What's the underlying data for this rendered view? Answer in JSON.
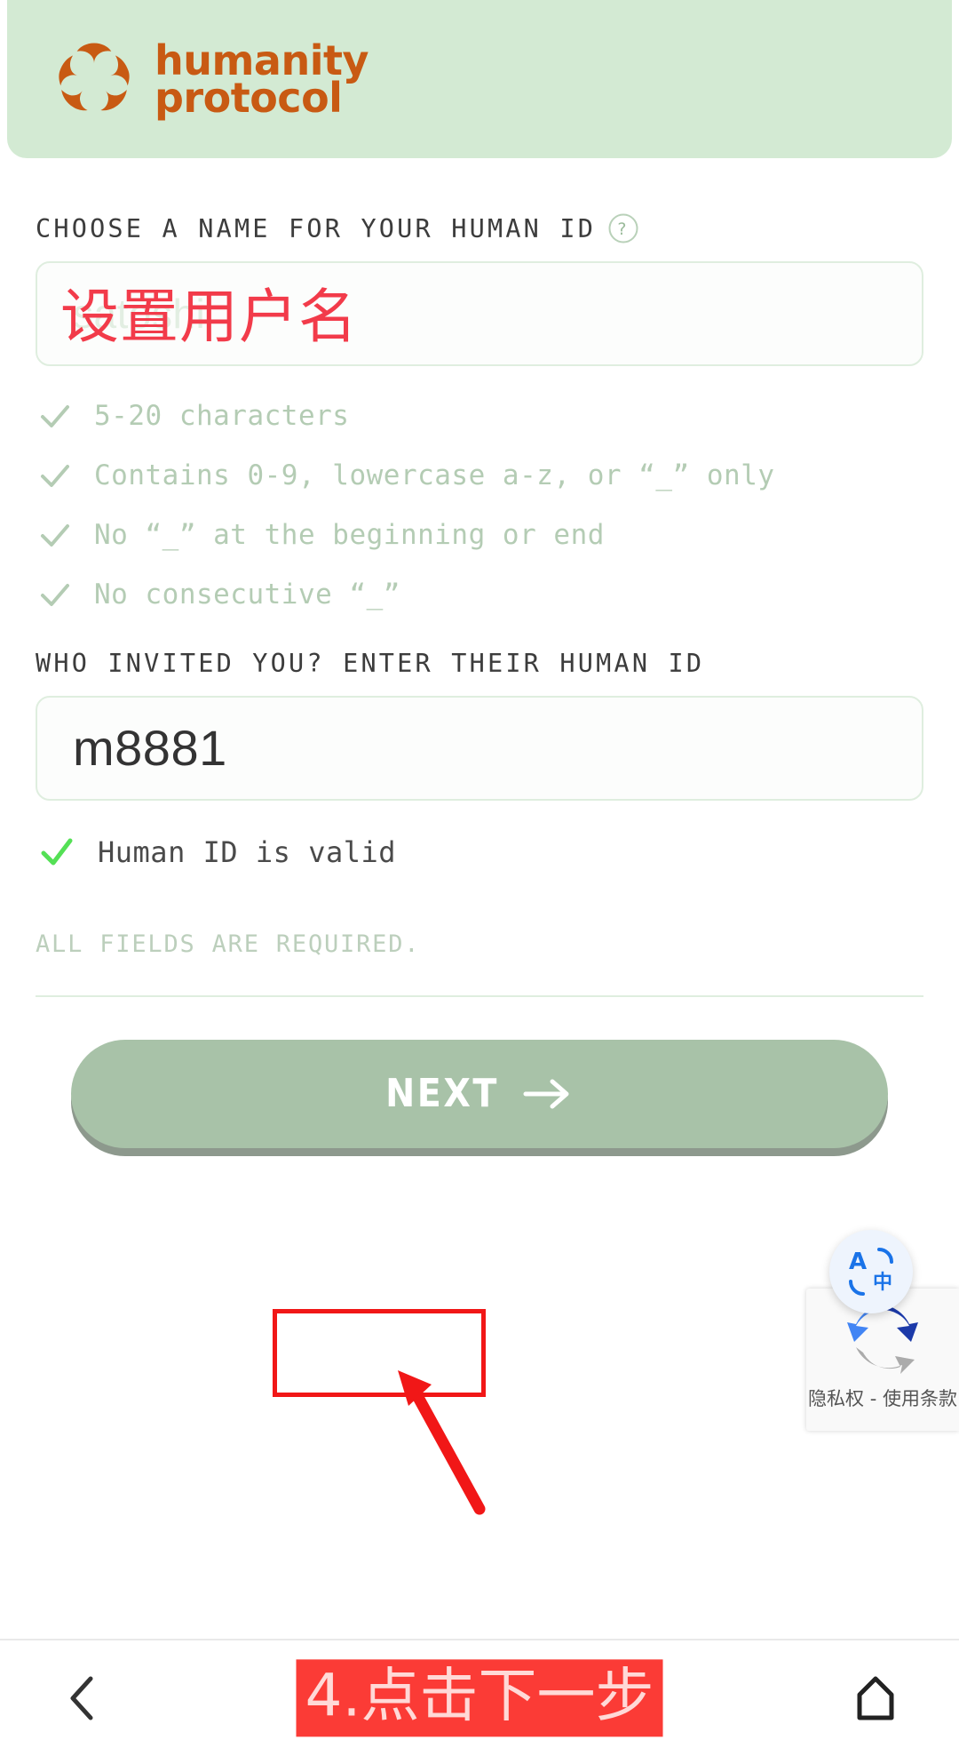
{
  "header": {
    "brand_line1": "humanity",
    "brand_line2": "protocol",
    "logo_icon": "humanity-protocol-logo",
    "bg_color": "#d3ead3",
    "brand_color": "#c85a13"
  },
  "form": {
    "name_field": {
      "label": "CHOOSE A NAME FOR YOUR HUMAN ID",
      "help_icon": "question-mark-icon",
      "placeholder": "satoshi",
      "value": "",
      "overlay_annotation": "设置用户名",
      "overlay_color": "#f23b4a"
    },
    "rules": [
      {
        "icon": "check-icon",
        "text": "5-20 characters",
        "state": "satisfied"
      },
      {
        "icon": "check-icon",
        "text": "Contains 0-9, lowercase a-z, or “_” only",
        "state": "satisfied"
      },
      {
        "icon": "check-icon",
        "text": "No “_” at the beginning or end",
        "state": "satisfied"
      },
      {
        "icon": "check-icon",
        "text": "No consecutive “_”",
        "state": "satisfied"
      }
    ],
    "inviter_field": {
      "label": "WHO INVITED YOU? ENTER THEIR HUMAN ID",
      "value": "m8881",
      "placeholder": ""
    },
    "validation": {
      "icon": "check-icon",
      "text": "Human ID is valid",
      "color": "#54e055"
    },
    "required_note": "ALL FIELDS ARE REQUIRED."
  },
  "actions": {
    "next_label": "NEXT",
    "next_arrow_icon": "arrow-right-icon",
    "next_bg_color": "#a8c2a8",
    "highlight_color": "#f11717"
  },
  "widgets": {
    "translate": {
      "icon": "translate-icon",
      "latin_glyph": "A",
      "cjk_glyph": "中"
    },
    "recaptcha": {
      "icon": "recaptcha-logo-icon",
      "links": "隐私权 - 使用条款"
    }
  },
  "navbar": {
    "back_icon": "chevron-left-icon",
    "home_icon": "home-icon",
    "annotation": "4.点击下一步",
    "annotation_bg": "#fb3b36"
  }
}
